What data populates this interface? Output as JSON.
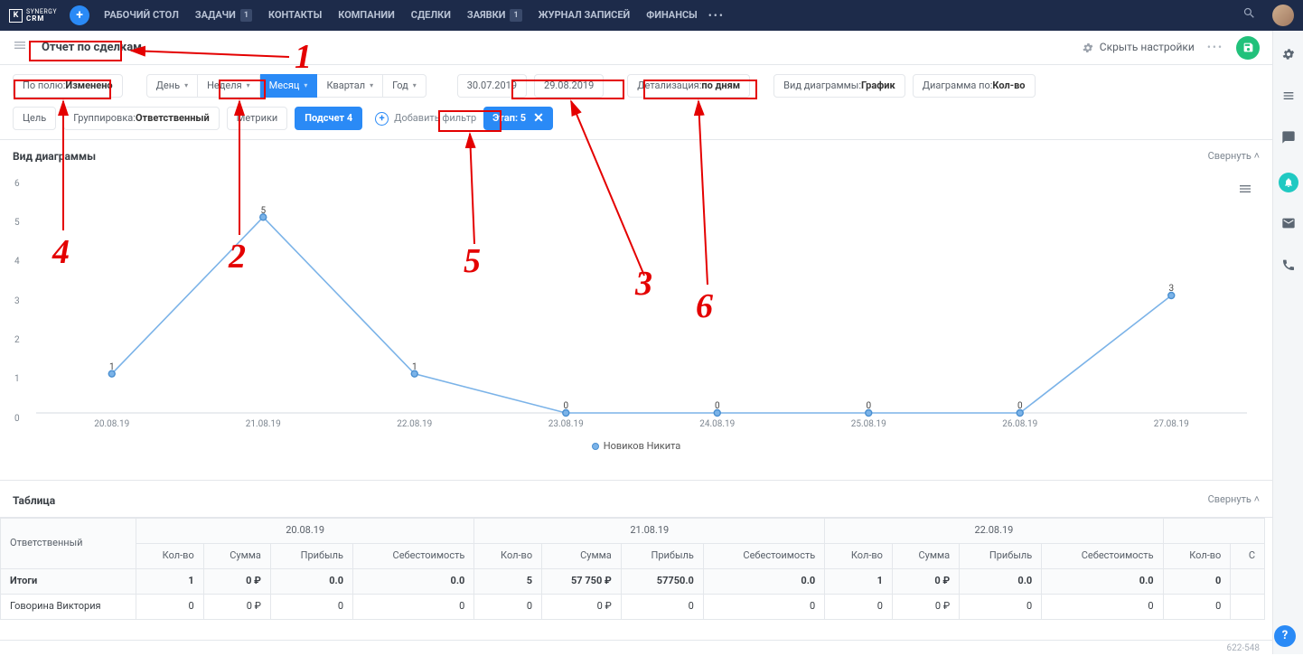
{
  "brand": {
    "top": "SYNERGY",
    "bottom": "CRM"
  },
  "nav": [
    {
      "label": "РАБОЧИЙ СТОЛ"
    },
    {
      "label": "ЗАДАЧИ",
      "badge": "1"
    },
    {
      "label": "КОНТАКТЫ"
    },
    {
      "label": "КОМПАНИИ"
    },
    {
      "label": "СДЕЛКИ"
    },
    {
      "label": "ЗАЯВКИ",
      "badge": "1"
    },
    {
      "label": "ЖУРНАЛ ЗАПИСЕЙ"
    },
    {
      "label": "ФИНАНСЫ"
    }
  ],
  "title": "Отчет по сделкам",
  "hide_settings": "Скрыть настройки",
  "filters": {
    "by_field": {
      "label": "По полю: ",
      "value": "Изменено"
    },
    "periods": [
      "День",
      "Неделя",
      "Месяц",
      "Квартал",
      "Год"
    ],
    "active_period": "Месяц",
    "date_from": "30.07.2019",
    "date_to": "29.08.2019",
    "detail": {
      "label": "Детализация: ",
      "value": "по дням"
    },
    "chart_type": {
      "label": "Вид диаграммы: ",
      "value": "График"
    },
    "chart_by": {
      "label": "Диаграмма по: ",
      "value": "Кол-во"
    },
    "goal": "Цель",
    "group": {
      "label": "Группировка: ",
      "value": "Ответственный"
    },
    "metrics": "Метрики",
    "count": "Подсчет 4",
    "add_filter": "Добавить фильтр",
    "chip": {
      "label": "Этап: 5"
    }
  },
  "chart_section": {
    "title": "Вид диаграммы",
    "collapse": "Свернуть"
  },
  "chart_data": {
    "type": "line",
    "categories": [
      "20.08.19",
      "21.08.19",
      "22.08.19",
      "23.08.19",
      "24.08.19",
      "25.08.19",
      "26.08.19",
      "27.08.19"
    ],
    "series": [
      {
        "name": "Новиков Никита",
        "values": [
          1,
          5,
          1,
          0,
          0,
          0,
          0,
          3
        ]
      }
    ],
    "ylim": [
      0,
      6
    ],
    "yticks": [
      0,
      1,
      2,
      3,
      4,
      5,
      6
    ]
  },
  "table_section": {
    "title": "Таблица",
    "collapse": "Свернуть"
  },
  "table": {
    "responsible_h": "Ответственный",
    "date_groups": [
      "20.08.19",
      "21.08.19",
      "22.08.19"
    ],
    "metrics": [
      "Кол-во",
      "Сумма",
      "Прибыль",
      "Себестоимость"
    ],
    "extra_col": "Кол-во",
    "totals_label": "Итоги",
    "totals": [
      [
        "1",
        "0 ₽",
        "0.0",
        "0.0"
      ],
      [
        "5",
        "57 750 ₽",
        "57750.0",
        "0.0"
      ],
      [
        "1",
        "0 ₽",
        "0.0",
        "0.0"
      ],
      [
        "0"
      ]
    ],
    "rows": [
      {
        "name": "Говорина Виктория",
        "cells": [
          [
            "0",
            "0 ₽",
            "0",
            "0"
          ],
          [
            "0",
            "0 ₽",
            "0",
            "0"
          ],
          [
            "0",
            "0 ₽",
            "0",
            "0"
          ],
          [
            "0"
          ]
        ]
      }
    ]
  },
  "annotations": [
    "1",
    "2",
    "3",
    "4",
    "5",
    "6"
  ],
  "footer": "622-548"
}
